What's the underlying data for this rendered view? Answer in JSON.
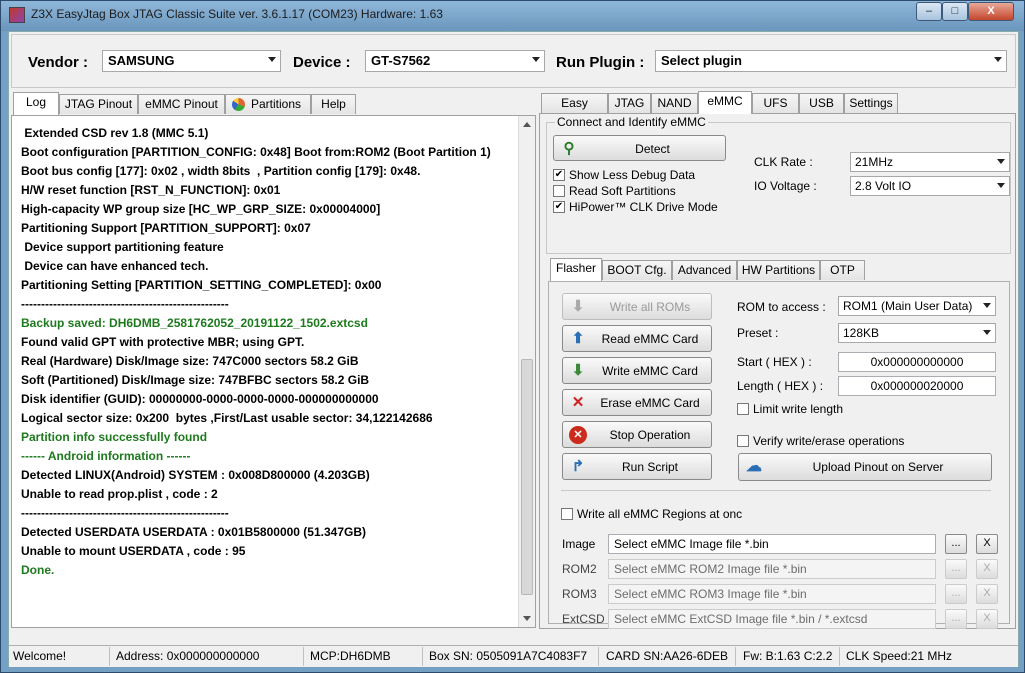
{
  "window": {
    "title": "Z3X EasyJtag Box JTAG Classic Suite ver. 3.6.1.17 (COM23) Hardware: 1.63",
    "min": "–",
    "max": "□",
    "close": "X"
  },
  "topbar": {
    "vendor_label": "Vendor :",
    "vendor_value": "SAMSUNG",
    "device_label": "Device :",
    "device_value": "GT-S7562",
    "plugin_label": "Run Plugin :",
    "plugin_value": "Select plugin"
  },
  "left_tabs": [
    "Log",
    "JTAG Pinout",
    "eMMC Pinout",
    "Partitions",
    "Help"
  ],
  "log": [
    {
      "text": " Extended CSD rev 1.8 (MMC 5.1)",
      "c": ""
    },
    {
      "text": "Boot configuration [PARTITION_CONFIG: 0x48] Boot from:ROM2 (Boot Partition 1)",
      "c": ""
    },
    {
      "text": "Boot bus config [177]: 0x02 , width 8bits  , Partition config [179]: 0x48.",
      "c": ""
    },
    {
      "text": "H/W reset function [RST_N_FUNCTION]: 0x01",
      "c": ""
    },
    {
      "text": "High-capacity WP group size [HC_WP_GRP_SIZE: 0x00004000]",
      "c": ""
    },
    {
      "text": "Partitioning Support [PARTITION_SUPPORT]: 0x07",
      "c": ""
    },
    {
      "text": " Device support partitioning feature",
      "c": ""
    },
    {
      "text": " Device can have enhanced tech.",
      "c": ""
    },
    {
      "text": "Partitioning Setting [PARTITION_SETTING_COMPLETED]: 0x00",
      "c": ""
    },
    {
      "text": "----------------------------------------------------",
      "c": ""
    },
    {
      "text": "Backup saved: DH6DMB_2581762052_20191122_1502.extcsd",
      "c": "green"
    },
    {
      "text": "Found valid GPT with protective MBR; using GPT.",
      "c": ""
    },
    {
      "text": "Real (Hardware) Disk/Image size: 747C000 sectors 58.2 GiB",
      "c": ""
    },
    {
      "text": "Soft (Partitioned) Disk/Image size: 747BFBC sectors 58.2 GiB",
      "c": ""
    },
    {
      "text": "Disk identifier (GUID): 00000000-0000-0000-0000-000000000000",
      "c": ""
    },
    {
      "text": "Logical sector size: 0x200  bytes ,First/Last usable sector: 34,122142686",
      "c": ""
    },
    {
      "text": "Partition info successfully found",
      "c": "green"
    },
    {
      "text": "------ Android information ------",
      "c": "green"
    },
    {
      "text": "Detected LINUX(Android) SYSTEM : 0x008D800000 (4.203GB)",
      "c": ""
    },
    {
      "text": "Unable to read prop.plist , code : 2",
      "c": ""
    },
    {
      "text": "----------------------------------------------------",
      "c": ""
    },
    {
      "text": "Detected USERDATA USERDATA : 0x01B5800000 (51.347GB)",
      "c": ""
    },
    {
      "text": "Unable to mount USERDATA , code : 95",
      "c": ""
    },
    {
      "text": "Done.",
      "c": "green"
    }
  ],
  "right_tabs": [
    "Easy Repair",
    "JTAG",
    "NAND",
    "eMMC",
    "UFS",
    "USB",
    "Settings"
  ],
  "connect": {
    "title": "Connect and Identify eMMC",
    "detect": "Detect",
    "show_less": "Show Less Debug Data",
    "read_soft": "Read Soft Partitions",
    "hipower": "HiPower™ CLK Drive Mode",
    "clk_label": "CLK Rate :",
    "clk_value": "21MHz",
    "io_label": "IO Voltage :",
    "io_value": "2.8 Volt IO"
  },
  "inner_tabs": [
    "Flasher",
    "BOOT Cfg.",
    "Advanced",
    "HW Partitions",
    "OTP"
  ],
  "flasher": {
    "write_all_roms": "Write all ROMs",
    "read_card": "Read eMMC Card",
    "write_card": "Write eMMC Card",
    "erase_card": "Erase eMMC Card",
    "stop": "Stop Operation",
    "run_script": "Run Script",
    "rom_label": "ROM to access :",
    "rom_value": "ROM1 (Main User Data)",
    "preset_label": "Preset :",
    "preset_value": "128KB",
    "start_label": "Start ( HEX ) :",
    "start_value": "0x000000000000",
    "length_label": "Length ( HEX ) :",
    "length_value": "0x000000020000",
    "limit_write": "Limit write length",
    "verify": "Verify write/erase operations",
    "upload": "Upload Pinout on Server",
    "write_all_regions": "Write all eMMC Regions at onc",
    "files": [
      {
        "label": "Image",
        "value": "Select eMMC Image file *.bin"
      },
      {
        "label": "ROM2",
        "value": "Select eMMC ROM2 Image file *.bin"
      },
      {
        "label": "ROM3",
        "value": "Select eMMC ROM3 Image file *.bin"
      },
      {
        "label": "ExtCSD",
        "value": "Select eMMC ExtCSD Image file *.bin / *.extcsd"
      }
    ],
    "browse": "...",
    "clear": "X"
  },
  "status": {
    "welcome": "Welcome!",
    "address": "Address: 0x000000000000",
    "mcp": "MCP:DH6DMB",
    "box_sn": "Box SN: 0505091A7C4083F7",
    "card_sn": "CARD SN:AA26-6DEB",
    "fw": "Fw: B:1.63 C:2.2",
    "clk": "CLK Speed:21 MHz"
  },
  "colors": {
    "green_text": "#1e7a1e",
    "titlebar": "#74a0c4",
    "erase_x": "#cc2222",
    "stop_red": "#cc2a1a"
  }
}
